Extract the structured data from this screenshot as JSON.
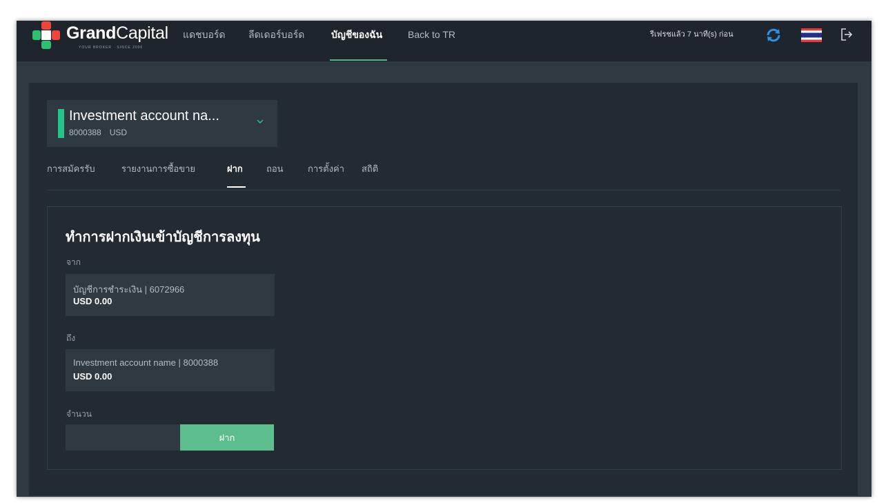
{
  "brand": {
    "name_bold": "Grand",
    "name_light": "Capital",
    "tagline": "YOUR BROKER · SINCE 2006"
  },
  "nav": {
    "items": [
      {
        "label": "แดชบอร์ด"
      },
      {
        "label": "ลีดเดอร์บอร์ด"
      },
      {
        "label": "บัญชีของฉัน",
        "active": true
      },
      {
        "label": "Back to TR"
      }
    ]
  },
  "header": {
    "refresh_text": "รีเฟรชแล้ว 7 นาที(s) ก่อน",
    "icons": [
      "refresh-icon",
      "thai-flag-icon",
      "logout-icon"
    ]
  },
  "account": {
    "name": "Investment account na...",
    "number": "8000388",
    "currency": "USD",
    "accent_color": "#24c387"
  },
  "tabs": [
    {
      "label": "การสมัครรับ"
    },
    {
      "label": "รายงานการซื้อขาย"
    },
    {
      "label": "ฝาก",
      "active": true
    },
    {
      "label": "ถอน"
    },
    {
      "label": "การตั้งค่า"
    },
    {
      "label": "สถิติ"
    }
  ],
  "form": {
    "title": "ทำการฝากเงินเข้าบัญชีการลงทุน",
    "from_label": "จาก",
    "from_account": "บัญชีการชำระเงิน | 6072966",
    "from_balance": "USD 0.00",
    "to_label": "ถึง",
    "to_account": "Investment account name | 8000388",
    "to_balance": "USD 0.00",
    "amount_label": "จำนวน",
    "amount_value": "",
    "amount_placeholder": "",
    "submit_label": "ฝาก",
    "submit_color": "#5dbd8c"
  }
}
